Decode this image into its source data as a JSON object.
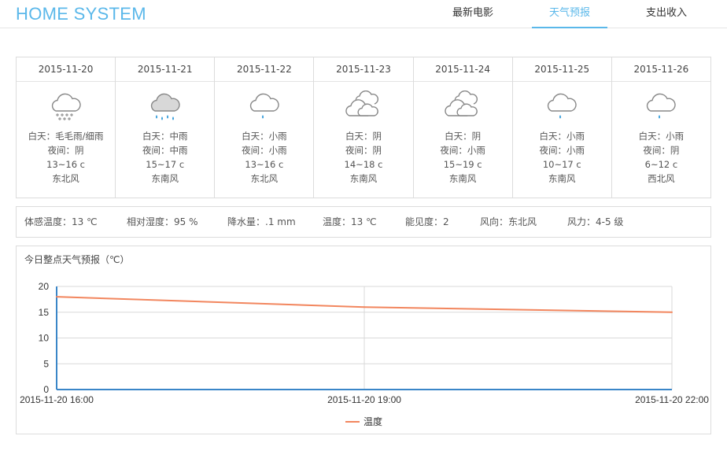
{
  "app": {
    "title": "HOME SYSTEM"
  },
  "nav": {
    "items": [
      {
        "label": "最新电影",
        "active": false
      },
      {
        "label": "天气预报",
        "active": true
      },
      {
        "label": "支出收入",
        "active": false
      }
    ]
  },
  "forecast": [
    {
      "date": "2015-11-20",
      "icon": "drizzle-icon",
      "day": "白天：毛毛雨/细雨",
      "night": "夜间：阴",
      "temp": "13~16 c",
      "wind": "东北风"
    },
    {
      "date": "2015-11-21",
      "icon": "rain-icon",
      "day": "白天：中雨",
      "night": "夜间：中雨",
      "temp": "15~17 c",
      "wind": "东南风"
    },
    {
      "date": "2015-11-22",
      "icon": "light-rain-icon",
      "day": "白天：小雨",
      "night": "夜间：小雨",
      "temp": "13~16 c",
      "wind": "东北风"
    },
    {
      "date": "2015-11-23",
      "icon": "overcast-icon",
      "day": "白天：阴",
      "night": "夜间：阴",
      "temp": "14~18 c",
      "wind": "东南风"
    },
    {
      "date": "2015-11-24",
      "icon": "overcast-icon",
      "day": "白天：阴",
      "night": "夜间：小雨",
      "temp": "15~19 c",
      "wind": "东南风"
    },
    {
      "date": "2015-11-25",
      "icon": "light-rain-icon",
      "day": "白天：小雨",
      "night": "夜间：小雨",
      "temp": "10~17 c",
      "wind": "东南风"
    },
    {
      "date": "2015-11-26",
      "icon": "light-rain-icon",
      "day": "白天：小雨",
      "night": "夜间：阴",
      "temp": "6~12 c",
      "wind": "西北风"
    }
  ],
  "stats": [
    {
      "text": "体感温度：13 ℃"
    },
    {
      "text": "相对湿度：95 %"
    },
    {
      "text": "降水量：.1 mm"
    },
    {
      "text": "温度：13 ℃"
    },
    {
      "text": "能见度：2"
    },
    {
      "text": "风向：东北风"
    },
    {
      "text": "风力：4-5 级"
    }
  ],
  "colors": {
    "accent": "#5bb8ea",
    "line": "#f2865e",
    "axis": "#3a86c8",
    "icon": "#3aa0dc"
  },
  "chart_data": {
    "type": "line",
    "title": "今日整点天气预报（℃）",
    "x": [
      "2015-11-20 16:00",
      "2015-11-20 19:00",
      "2015-11-20 22:00"
    ],
    "series": [
      {
        "name": "温度",
        "values": [
          18,
          16,
          15
        ]
      }
    ],
    "ylim": [
      0,
      20
    ],
    "yticks": [
      0,
      5,
      10,
      15,
      20
    ],
    "grid": true,
    "legend": "bottom"
  }
}
